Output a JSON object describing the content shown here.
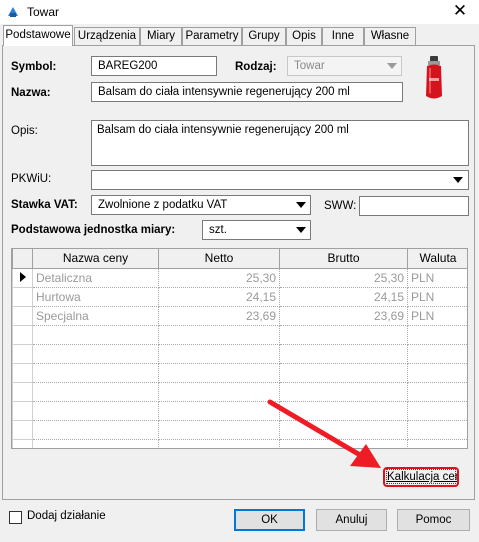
{
  "window": {
    "title": "Towar",
    "close_icon": "close-icon"
  },
  "tabs": [
    {
      "label": "Podstawowe",
      "active": true
    },
    {
      "label": "Urządzenia"
    },
    {
      "label": "Miary"
    },
    {
      "label": "Parametry"
    },
    {
      "label": "Grupy"
    },
    {
      "label": "Opis"
    },
    {
      "label": "Inne"
    },
    {
      "label": "Własne"
    }
  ],
  "form": {
    "symbol_label": "Symbol:",
    "symbol_value": "BAREG200",
    "rodzaj_label": "Rodzaj:",
    "rodzaj_value": "Towar",
    "nazwa_label": "Nazwa:",
    "nazwa_value": "Balsam do ciała intensywnie regenerujący 200 ml",
    "opis_label": "Opis:",
    "opis_value": "Balsam do ciała intensywnie regenerujący 200 ml",
    "pkwiu_label": "PKWiU:",
    "pkwiu_value": "",
    "vat_label": "Stawka VAT:",
    "vat_value": "Zwolnione z podatku VAT",
    "sww_label": "SWW:",
    "sww_value": "",
    "unit_label": "Podstawowa jednostka miary:",
    "unit_value": "szt."
  },
  "price_table": {
    "columns": [
      "Nazwa ceny",
      "Netto",
      "Brutto",
      "Waluta"
    ],
    "rows": [
      [
        "Detaliczna",
        "25,30",
        "25,30",
        "PLN"
      ],
      [
        "Hurtowa",
        "24,15",
        "24,15",
        "PLN"
      ],
      [
        "Specjalna",
        "23,69",
        "23,69",
        "PLN"
      ]
    ]
  },
  "kalkulacja_label": "Kalkulacja ceny",
  "footer": {
    "dodaj_label": "Dodaj działanie",
    "ok_label": "OK",
    "anuluj_label": "Anuluj",
    "pomoc_label": "Pomoc"
  },
  "colors": {
    "highlight": "#e1101c",
    "annotation_arrow": "#ee1c24"
  }
}
